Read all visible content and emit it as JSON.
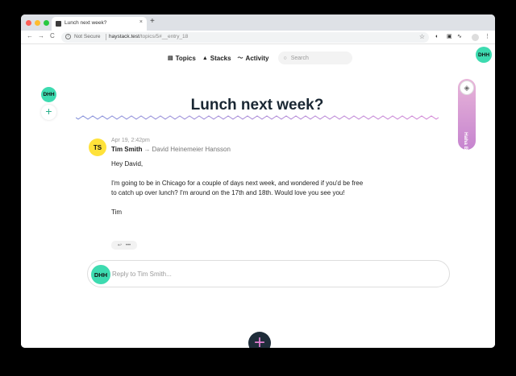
{
  "browser": {
    "tab_title": "Lunch next week?",
    "tab_close": "×",
    "new_tab": "+",
    "back": "←",
    "forward": "→",
    "reload": "C",
    "security": "Not Secure",
    "url_host": "haystack.test",
    "url_path": "/topics/5#__entry_18",
    "star": "☆",
    "ext_1": "◐",
    "ext_2": "▣",
    "ext_3": "∿",
    "menu": "⋮"
  },
  "nav": {
    "topics": "Topics",
    "stacks": "Stacks",
    "activity": "Activity",
    "search_placeholder": "Search"
  },
  "user_initials": "DHH",
  "boost_label": "Haha Business",
  "topic_title": "Lunch next week?",
  "entry": {
    "author_initials": "TS",
    "time": "Apr 19, 2:42pm",
    "author": "Tim Smith",
    "arrow": "→",
    "recipient": "David Heinemeier Hansson",
    "paragraphs": [
      "Hey David,",
      "I'm going to be in Chicago for a couple of days next week, and wondered if you'd be free",
      "to catch up over lunch? I'm around on the 17th and 18th. Would love you see you!",
      "Tim"
    ],
    "reply_icon": "↩",
    "more_icon": "•••"
  },
  "reply_placeholder": "Reply to Tim Smith...",
  "colors": {
    "accent": "#3ddbb0",
    "title": "#1a2733",
    "wavy_a": "#7d8bd8",
    "wavy_b": "#d17fd3"
  }
}
